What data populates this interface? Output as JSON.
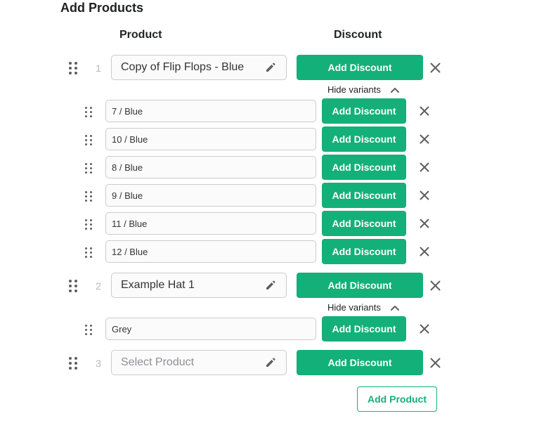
{
  "page_title": "Add Products",
  "columns": {
    "product": "Product",
    "discount": "Discount"
  },
  "products": [
    {
      "index": "1",
      "name": "Copy of Flip Flops - Blue",
      "discount_label": "Add Discount",
      "variants_toggle": "Hide variants",
      "variants": [
        {
          "name": "7 / Blue",
          "discount_label": "Add Discount"
        },
        {
          "name": "10 / Blue",
          "discount_label": "Add Discount"
        },
        {
          "name": "8 / Blue",
          "discount_label": "Add Discount"
        },
        {
          "name": "9 / Blue",
          "discount_label": "Add Discount"
        },
        {
          "name": "11 / Blue",
          "discount_label": "Add Discount"
        },
        {
          "name": "12 / Blue",
          "discount_label": "Add Discount"
        }
      ]
    },
    {
      "index": "2",
      "name": "Example Hat 1",
      "discount_label": "Add Discount",
      "variants_toggle": "Hide variants",
      "variants": [
        {
          "name": "Grey",
          "discount_label": "Add Discount"
        }
      ]
    },
    {
      "index": "3",
      "placeholder": "Select Product",
      "discount_label": "Add Discount"
    }
  ],
  "add_product_label": "Add Product",
  "colors": {
    "accent": "#14b07a",
    "border": "#c9cccf",
    "icon": "#5c5f62"
  },
  "icons": [
    "drag-handle-icon",
    "pencil-icon",
    "close-icon",
    "chevron-up-icon"
  ]
}
